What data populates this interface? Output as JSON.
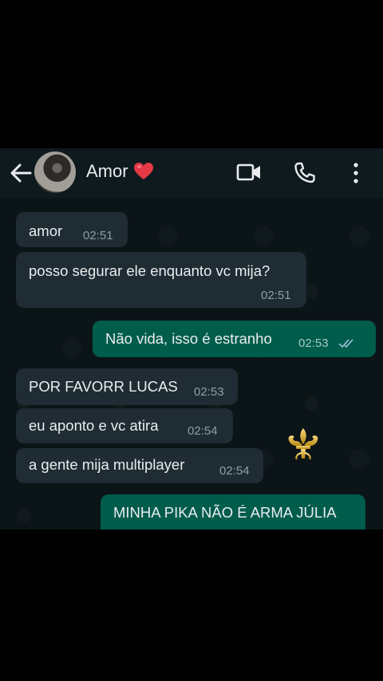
{
  "header": {
    "contact_name": "Amor",
    "heart_icon": "red-heart-emoji",
    "icons": [
      "back-arrow-icon",
      "video-call-icon",
      "phone-call-icon",
      "more-vertical-icon"
    ]
  },
  "messages": [
    {
      "direction": "incoming",
      "text": "amor",
      "time": "02:51"
    },
    {
      "direction": "incoming",
      "text": "posso segurar ele enquanto vc mija?",
      "time": "02:51"
    },
    {
      "direction": "outgoing",
      "text": "Não vida, isso é estranho",
      "time": "02:53",
      "status": "read"
    },
    {
      "direction": "incoming",
      "text": "POR FAVORR LUCAS",
      "time": "02:53"
    },
    {
      "direction": "incoming",
      "text": "eu aponto e vc atira",
      "time": "02:54"
    },
    {
      "direction": "incoming",
      "text": "a gente mija multiplayer",
      "time": "02:54"
    },
    {
      "direction": "outgoing",
      "text": "MINHA PIKA NÃO É ARMA JÚLIA",
      "time": ""
    }
  ],
  "colors": {
    "incoming_bubble": "#1f2c33",
    "outgoing_bubble": "#005c4b",
    "header_bg": "#0f1a1e",
    "chat_bg": "#0b1417",
    "read_ticks": "#53bdeb"
  }
}
